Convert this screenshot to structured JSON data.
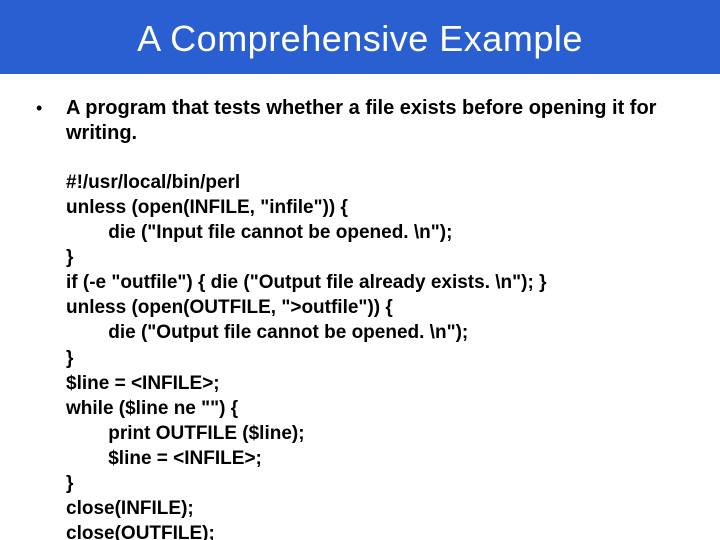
{
  "title": "A Comprehensive Example",
  "bullet_symbol": "•",
  "description": "A program that tests whether a file exists before opening it for writing.",
  "code": "#!/usr/local/bin/perl\nunless (open(INFILE, \"infile\")) {\n        die (\"Input file cannot be opened. \\n\");\n}\nif (-e \"outfile\") { die (\"Output file already exists. \\n\"); }\nunless (open(OUTFILE, \">outfile\")) {\n        die (\"Output file cannot be opened. \\n\");\n}\n$line = <INFILE>;\nwhile ($line ne \"\") {\n        print OUTFILE ($line);\n        $line = <INFILE>;\n}\nclose(INFILE);\nclose(OUTFILE);"
}
